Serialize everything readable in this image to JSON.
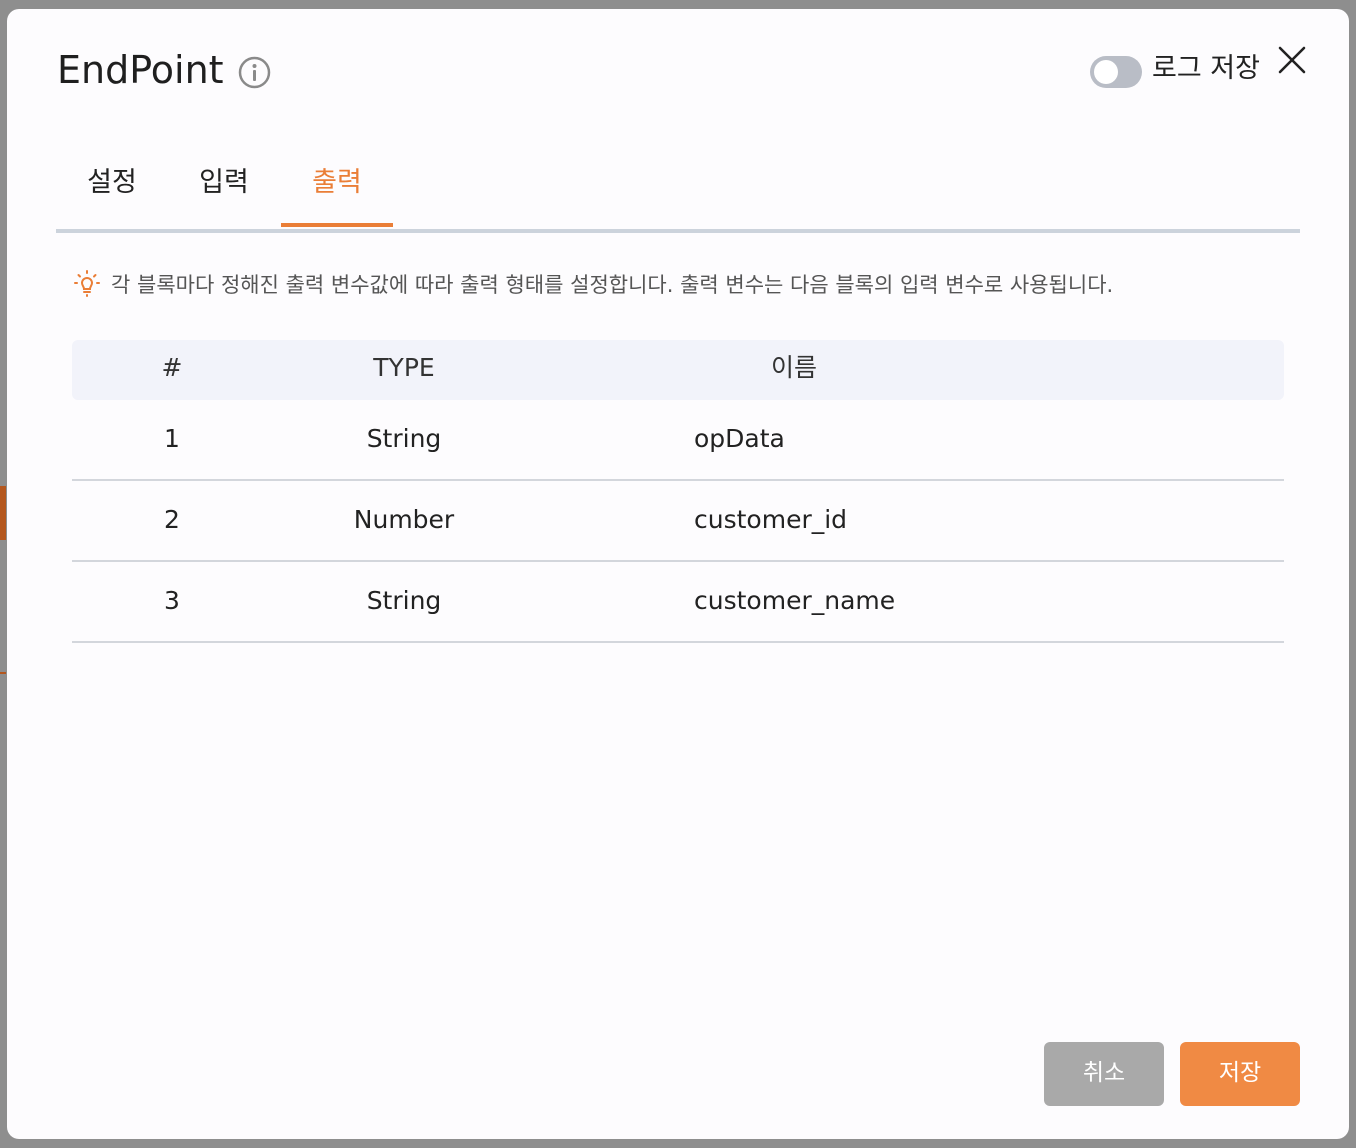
{
  "dialog": {
    "title": "EndPoint",
    "log_toggle_label": "로그 저장",
    "log_toggle_on": false
  },
  "tabs": [
    {
      "label": "설정",
      "active": false
    },
    {
      "label": "입력",
      "active": false
    },
    {
      "label": "출력",
      "active": true
    }
  ],
  "hint": {
    "text": "각 블록마다 정해진 출력 변수값에 따라 출력 형태를 설정합니다. 출력 변수는 다음 블록의 입력 변수로 사용됩니다."
  },
  "table": {
    "headers": [
      "#",
      "TYPE",
      "이름"
    ],
    "rows": [
      {
        "index": "1",
        "type": "String",
        "name": "opData"
      },
      {
        "index": "2",
        "type": "Number",
        "name": "customer_id"
      },
      {
        "index": "3",
        "type": "String",
        "name": "customer_name"
      }
    ]
  },
  "footer": {
    "cancel_label": "취소",
    "save_label": "저장"
  },
  "colors": {
    "accent": "#ea7e37",
    "save_button": "#f08a44",
    "cancel_button": "#a9a9a9",
    "toggle_off": "#b9bdc6",
    "table_header_bg": "#f2f3fa"
  },
  "icons": {
    "info": "info-icon",
    "close": "close-icon",
    "hint": "lightbulb-icon"
  }
}
